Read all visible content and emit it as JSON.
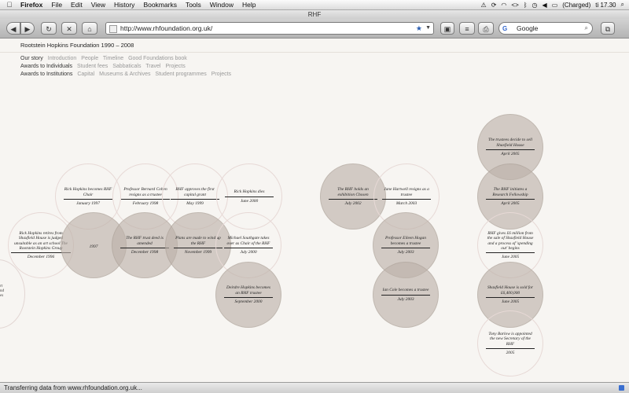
{
  "menubar": {
    "apple": "",
    "items": [
      "Firefox",
      "File",
      "Edit",
      "View",
      "History",
      "Bookmarks",
      "Tools",
      "Window",
      "Help"
    ],
    "battery": "(Charged)",
    "clock": "ti 17.30"
  },
  "window": {
    "title": "RHF"
  },
  "toolbar": {
    "back": "◀",
    "forward": "▶",
    "reload": "↻",
    "stop": "✕",
    "home": "⌂",
    "url": "http://www.rhfoundation.org.uk/",
    "search_placeholder": "Google"
  },
  "site": {
    "title": "Rootstein Hopkins Foundation 1990 – 2008",
    "nav": [
      {
        "head": "Our story",
        "links": [
          "Introduction",
          "People",
          "Timeline",
          "Good Foundations book"
        ]
      },
      {
        "head": "Awards to Individuals",
        "links": [
          "Student fees",
          "Sabbaticals",
          "Travel",
          "Projects"
        ]
      },
      {
        "head": "Awards to Institutions",
        "links": [
          "Capital",
          "Museums & Archives",
          "Student programmes",
          "Projects"
        ]
      }
    ]
  },
  "timeline": {
    "stub_text": "rt\nnd\nes",
    "events": [
      {
        "text": "Rick Hopkins becomes RHF Chair",
        "date": "January 1997"
      },
      {
        "text": "Professor Bernard Cohen resigns as a trustee",
        "date": "February 1998"
      },
      {
        "text": "RHF approves the first capital grant",
        "date": "May 1999"
      },
      {
        "text": "Rick Hopkins dies",
        "date": "June 2000"
      },
      {
        "text": "Rick Hopkins retires from Shaxfield House is judged unsuitable as an art school The Rootstein Hopkins Group",
        "date": "December 1996"
      },
      {
        "text": "",
        "date": "1997"
      },
      {
        "text": "The RHF trust deed is amended",
        "date": "December 1998"
      },
      {
        "text": "Plans are made to wind up the RHF",
        "date": "November 1999"
      },
      {
        "text": "Michael Southgate takes over as Chair of the RHF",
        "date": "July 2000"
      },
      {
        "text": "Deirdre Hopkins becomes an RHF trustee",
        "date": "September 2000"
      },
      {
        "text": "The RHF holds an exhibition Chosen",
        "date": "July 2002"
      },
      {
        "text": "Jane Hartwell resigns as a trustee",
        "date": "March 2003"
      },
      {
        "text": "Professor Eileen Hogan becomes a trustee",
        "date": "July 2003"
      },
      {
        "text": "Ian Cole becomes a trustee",
        "date": "July 2003"
      },
      {
        "text": "The trustees decide to sell Shaxfield House",
        "date": "April 2005"
      },
      {
        "text": "The RHF initiates a Research Fellowship",
        "date": "April 2005"
      },
      {
        "text": "RHF gives £6 million from the sale of Shaxfield House and a process of 'spending out' begins",
        "date": "June 2005"
      },
      {
        "text": "Shaxfield House is sold for £6,400,000",
        "date": "June 2005"
      },
      {
        "text": "Tony Barlow is appointed the new Secretary of the RHF",
        "date": "2005"
      }
    ]
  },
  "status": {
    "text": "Transferring data from www.rhfoundation.org.uk..."
  }
}
